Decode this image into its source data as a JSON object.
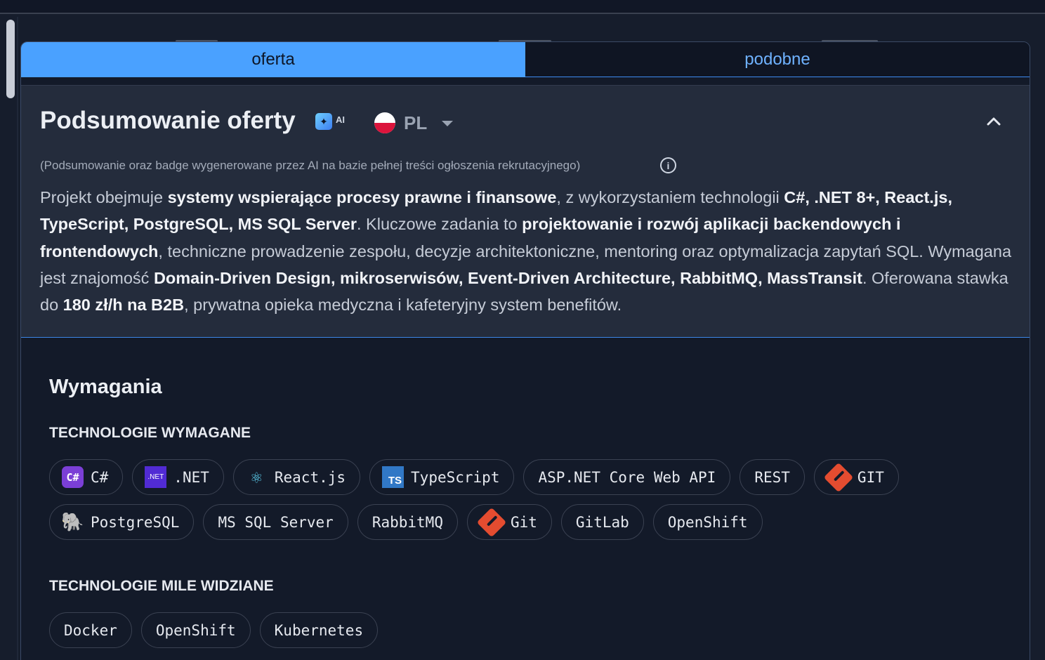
{
  "tabs": [
    {
      "label": "oferta",
      "active": true
    },
    {
      "label": "podobne",
      "active": false
    }
  ],
  "summary": {
    "title": "Podsumowanie oferty",
    "ai_label": "AI",
    "language": "PL",
    "disclaimer": "(Podsumowanie oraz badge wygenerowane przez AI na bazie pełnej treści ogłoszenia rekrutacyjnego)",
    "paragraph": [
      {
        "text": "Projekt obejmuje ",
        "bold": false
      },
      {
        "text": "systemy wspierające procesy prawne i finansowe",
        "bold": true
      },
      {
        "text": ", z wykorzystaniem technologii ",
        "bold": false
      },
      {
        "text": "C#, .NET 8+, React.js, TypeScript, PostgreSQL, MS SQL Server",
        "bold": true
      },
      {
        "text": ". Kluczowe zadania to ",
        "bold": false
      },
      {
        "text": "projektowanie i rozwój aplikacji backendowych i frontendowych",
        "bold": true
      },
      {
        "text": ", techniczne prowadzenie zespołu, decyzje architektoniczne, mentoring oraz optymalizacja zapytań SQL. Wymagana jest znajomość ",
        "bold": false
      },
      {
        "text": "Domain-Driven Design, mikroserwisów, Event-Driven Architecture, RabbitMQ, MassTransit",
        "bold": true
      },
      {
        "text": ". Oferowana stawka do ",
        "bold": false
      },
      {
        "text": "180 zł/h na B2B",
        "bold": true
      },
      {
        "text": ", prywatna opieka medyczna i kafeteryjny system benefitów.",
        "bold": false
      }
    ]
  },
  "requirements": {
    "title": "Wymagania",
    "required_title": "TECHNOLOGIE WYMAGANE",
    "required": [
      {
        "label": "C#",
        "icon": "csharp-icon"
      },
      {
        "label": ".NET",
        "icon": "dotnet-icon"
      },
      {
        "label": "React.js",
        "icon": "react-icon"
      },
      {
        "label": "TypeScript",
        "icon": "typescript-icon"
      },
      {
        "label": "ASP.NET Core Web API",
        "icon": ""
      },
      {
        "label": "REST",
        "icon": ""
      },
      {
        "label": "GIT",
        "icon": "git-icon"
      },
      {
        "label": "PostgreSQL",
        "icon": "postgresql-icon"
      },
      {
        "label": "MS SQL Server",
        "icon": ""
      },
      {
        "label": "RabbitMQ",
        "icon": ""
      },
      {
        "label": "Git",
        "icon": "git-icon"
      },
      {
        "label": "GitLab",
        "icon": ""
      },
      {
        "label": "OpenShift",
        "icon": ""
      }
    ],
    "nice_title": "TECHNOLOGIE MILE WIDZIANE",
    "nice": [
      {
        "label": "Docker",
        "icon": ""
      },
      {
        "label": "OpenShift",
        "icon": ""
      },
      {
        "label": "Kubernetes",
        "icon": ""
      }
    ]
  },
  "colors": {
    "accent": "#4aa1ff",
    "background": "#161d2c",
    "summary_bg": "#242c3c"
  }
}
